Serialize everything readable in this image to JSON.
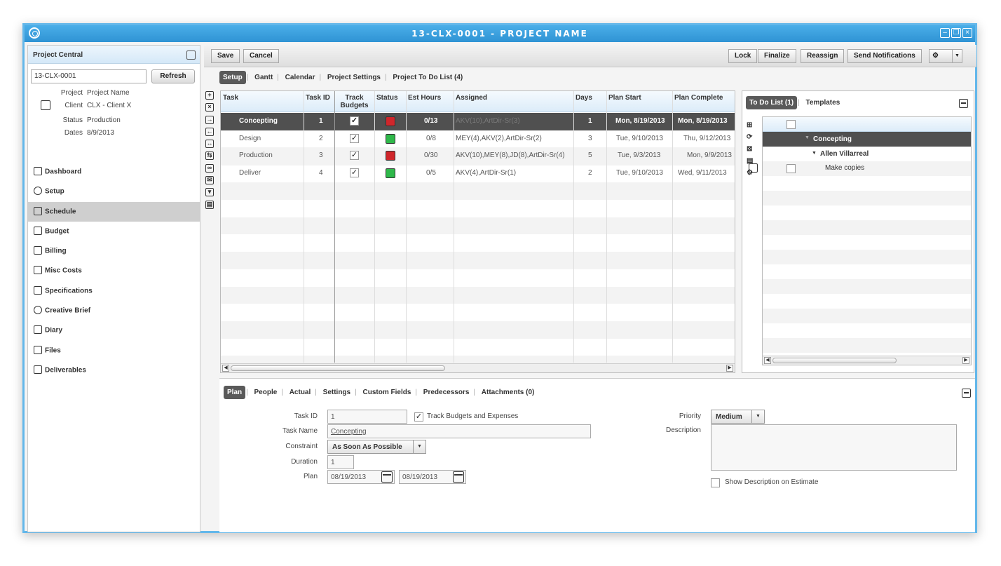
{
  "window": {
    "title": "13-CLX-0001 - PROJECT NAME"
  },
  "left": {
    "header": "Project Central",
    "project_input": "13-CLX-0001",
    "refresh": "Refresh",
    "info": [
      {
        "label": "Project",
        "value": "Project Name"
      },
      {
        "label": "Client",
        "value": "CLX - Client X"
      },
      {
        "label": "Status",
        "value": "Production"
      },
      {
        "label": "Dates",
        "value": "8/9/2013"
      }
    ],
    "nav": [
      {
        "label": "Dashboard",
        "icon": "dashboard-icon"
      },
      {
        "label": "Setup",
        "icon": "setup-icon"
      },
      {
        "label": "Schedule",
        "icon": "schedule-icon"
      },
      {
        "label": "Budget",
        "icon": "budget-icon"
      },
      {
        "label": "Billing",
        "icon": "billing-icon"
      },
      {
        "label": "Misc Costs",
        "icon": "misc-costs-icon"
      },
      {
        "label": "Specifications",
        "icon": "specifications-icon"
      },
      {
        "label": "Creative Brief",
        "icon": "creative-brief-icon"
      },
      {
        "label": "Diary",
        "icon": "diary-icon"
      },
      {
        "label": "Files",
        "icon": "files-icon"
      },
      {
        "label": "Deliverables",
        "icon": "deliverables-icon"
      }
    ]
  },
  "toolbar": {
    "save": "Save",
    "cancel": "Cancel",
    "lock": "Lock",
    "finalize": "Finalize",
    "reassign": "Reassign",
    "send": "Send Notifications"
  },
  "tabs": [
    "Setup",
    "Gantt",
    "Calendar",
    "Project Settings",
    "Project To Do List (4)"
  ],
  "grid": {
    "columns": [
      "Task",
      "Task ID",
      "Track Budgets",
      "Status",
      "Est Hours",
      "Assigned",
      "Days",
      "Plan Start",
      "Plan Complete"
    ],
    "rows": [
      {
        "task": "Concepting",
        "id": "1",
        "track": "✓",
        "status_color": "#d0262b",
        "est": "0/13",
        "assigned": "AKV(10),ArtDir-Sr(3)",
        "days": "1",
        "start": "Mon, 8/19/2013",
        "complete": "Mon, 8/19/2013"
      },
      {
        "task": "Design",
        "id": "2",
        "track": "✓",
        "status_color": "#2fb84a",
        "est": "0/8",
        "assigned": "MEY(4),AKV(2),ArtDir-Sr(2)",
        "days": "3",
        "start": "Tue, 9/10/2013",
        "complete": "Thu, 9/12/2013"
      },
      {
        "task": "Production",
        "id": "3",
        "track": "✓",
        "status_color": "#d0262b",
        "est": "0/30",
        "assigned": "AKV(10),MEY(8),JD(8),ArtDir-Sr(4)",
        "days": "5",
        "start": "Tue, 9/3/2013",
        "complete": "Mon, 9/9/2013"
      },
      {
        "task": "Deliver",
        "id": "4",
        "track": "✓",
        "status_color": "#2fb84a",
        "est": "0/5",
        "assigned": "AKV(4),ArtDir-Sr(1)",
        "days": "2",
        "start": "Tue, 9/10/2013",
        "complete": "Wed, 9/11/2013"
      }
    ]
  },
  "todo": {
    "tab_active": "To Do List (1)",
    "tab_other": "Templates",
    "tree": [
      {
        "label": "Concepting"
      },
      {
        "label": "Allen Villarreal"
      },
      {
        "label": "Make copies"
      }
    ]
  },
  "detail": {
    "tabs": [
      "Plan",
      "People",
      "Actual",
      "Settings",
      "Custom Fields",
      "Predecessors",
      "Attachments (0)"
    ],
    "task_id_label": "Task ID",
    "task_id": "1",
    "track_label": "Track Budgets and Expenses",
    "task_name_label": "Task Name",
    "task_name": "Concepting",
    "constraint_label": "Constraint",
    "constraint": "As Soon As Possible",
    "duration_label": "Duration",
    "duration": "1",
    "plan_label": "Plan",
    "plan_start": "08/19/2013",
    "plan_end": "08/19/2013",
    "priority_label": "Priority",
    "priority": "Medium",
    "description_label": "Description",
    "show_desc": "Show Description on Estimate"
  }
}
